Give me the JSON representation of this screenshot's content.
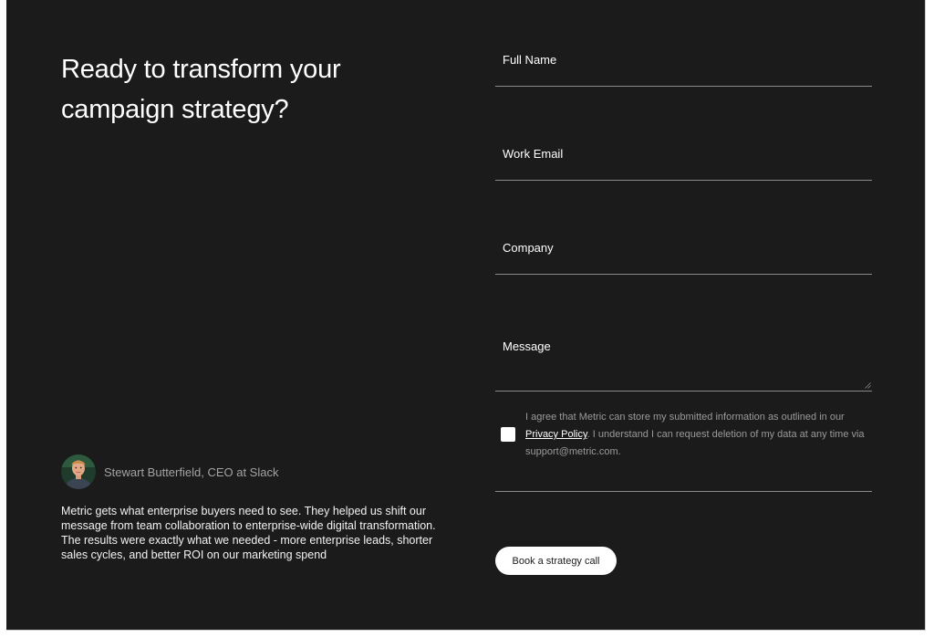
{
  "hero": {
    "headline": "Ready to transform your campaign strategy?"
  },
  "testimonial": {
    "author": "Stewart Butterfield, CEO at Slack",
    "avatar_icon": "person-avatar",
    "quote": "Metric gets what enterprise buyers need to see. They helped us shift our message from team collaboration to enterprise-wide digital transformation. The results were exactly what we needed - more enterprise leads, shorter sales cycles, and better ROI on our marketing spend"
  },
  "form": {
    "full_name": {
      "label": "Full Name",
      "value": ""
    },
    "work_email": {
      "label": "Work Email",
      "value": ""
    },
    "company": {
      "label": "Company",
      "value": ""
    },
    "message": {
      "label": "Message",
      "value": ""
    },
    "consent": {
      "checked": false,
      "text_before": "I agree that Metric can store my submitted information as outlined in our ",
      "link": "Privacy Policy",
      "text_after": ". I understand I can request deletion of my data at any time via support@metric.com."
    },
    "submit_label": "Book a strategy call"
  },
  "colors": {
    "background": "#1b1b1b",
    "text": "#ffffff",
    "muted": "#9a9a9a",
    "divider": "#8a8a8a",
    "button_bg": "#ffffff",
    "button_text": "#1b1b1b"
  }
}
